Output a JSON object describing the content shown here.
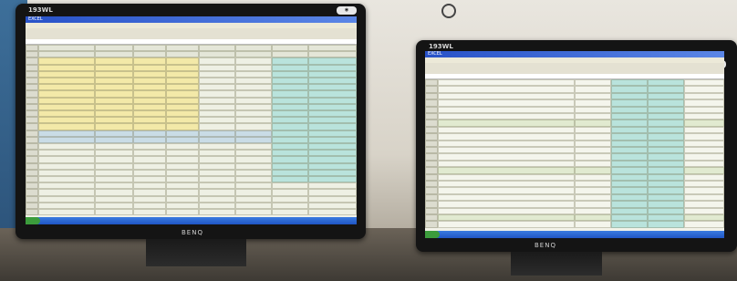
{
  "scene": {
    "colors": {
      "bezel": "#141414",
      "screen_bg": "#f1f2e8",
      "titlebar": "#2852c8",
      "yellow_cells": "#f3e9a8",
      "teal_cells": "#b9e3dc",
      "desk": "#4e4840"
    }
  },
  "left_monitor": {
    "model_label": "193WL",
    "brand_label": "BENQ",
    "logo_icon": "ati-logo-icon",
    "sheet_title": "EXCEL"
  },
  "right_monitor": {
    "model_label": "193WL",
    "brand_label": "BENQ",
    "logo_icon": "ati-logo-icon",
    "sheet_title": "EXCEL"
  }
}
